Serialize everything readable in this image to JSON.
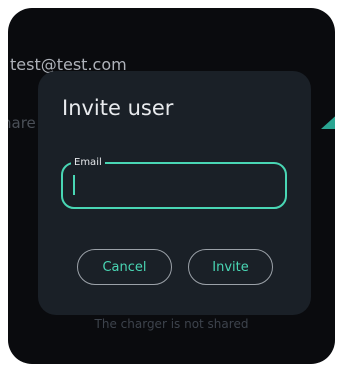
{
  "background": {
    "account_email": "test@test.com",
    "share_label_partial": "hare",
    "footer_text": "The charger is not shared"
  },
  "dialog": {
    "title": "Invite user",
    "email_field": {
      "label": "Email",
      "value": "",
      "placeholder": ""
    },
    "cancel_label": "Cancel",
    "invite_label": "Invite"
  },
  "colors": {
    "accent": "#49d6b4",
    "dialog_bg": "#1a2027",
    "screen_bg": "#0a0b0e"
  }
}
